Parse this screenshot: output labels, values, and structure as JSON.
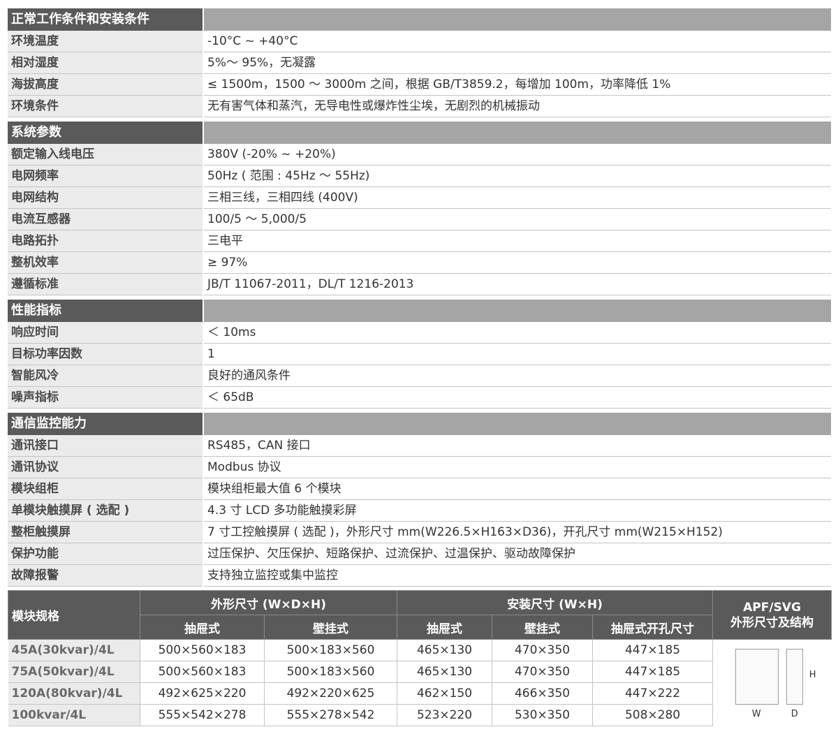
{
  "sections": [
    {
      "title": "正常工作条件和安装条件",
      "rows": [
        {
          "label": "环境温度",
          "value": "-10°C ~ +40°C"
        },
        {
          "label": "相对湿度",
          "value": "5%～ 95%，无凝露"
        },
        {
          "label": "海拔高度",
          "value": "≤ 1500m，1500 ～ 3000m 之间，根据 GB/T3859.2，每增加 100m，功率降低 1%"
        },
        {
          "label": "环境条件",
          "value": "无有害气体和蒸汽，无导电性或爆炸性尘埃，无剧烈的机械振动"
        }
      ]
    },
    {
      "title": "系统参数",
      "rows": [
        {
          "label": "额定输入线电压",
          "value": "380V (-20% ~ +20%)"
        },
        {
          "label": "电网频率",
          "value": "50Hz ( 范围 : 45Hz ～ 55Hz)"
        },
        {
          "label": "电网结构",
          "value": "三相三线，三相四线 (400V)"
        },
        {
          "label": "电流互感器",
          "value": "100/5 ～ 5,000/5"
        },
        {
          "label": "电路拓扑",
          "value": "三电平"
        },
        {
          "label": "整机效率",
          "value": "≥ 97%"
        },
        {
          "label": "遵循标准",
          "value": "JB/T 11067-2011，DL/T 1216-2013"
        }
      ]
    },
    {
      "title": "性能指标",
      "rows": [
        {
          "label": "响应时间",
          "value": "＜ 10ms"
        },
        {
          "label": "目标功率因数",
          "value": "1"
        },
        {
          "label": "智能风冷",
          "value": "良好的通风条件"
        },
        {
          "label": "噪声指标",
          "value": "＜ 65dB"
        }
      ]
    },
    {
      "title": "通信监控能力",
      "rows": [
        {
          "label": "通讯接口",
          "value": "RS485，CAN 接口"
        },
        {
          "label": "通讯协议",
          "value": "Modbus 协议"
        },
        {
          "label": "模块组柜",
          "value": "模块组柜最大值 6 个模块"
        },
        {
          "label": "单模块触摸屏 ( 选配 )",
          "value": "4.3 寸 LCD 多功能触摸彩屏"
        },
        {
          "label": "整柜触摸屏",
          "value": "7 寸工控触摸屏 ( 选配 )，外形尺寸 mm(W226.5×H163×D36)，开孔尺寸 mm(W215×H152)"
        },
        {
          "label": "保护功能",
          "value": "过压保护、欠压保护、短路保护、过流保护、过温保护、驱动故障保护"
        },
        {
          "label": "故障报警",
          "value": "支持独立监控或集中监控"
        }
      ]
    }
  ],
  "dimensions": {
    "header": {
      "model": "模块规格",
      "outer": "外形尺寸 (W×D×H)",
      "install": "安装尺寸 (W×H)",
      "apf": "APF/SVG\n外形尺寸及结构",
      "drawer": "抽屉式",
      "wall": "壁挂式",
      "install_drawer": "抽屉式",
      "install_wall": "壁挂式",
      "cutout": "抽屉式开孔尺寸"
    },
    "rows": [
      {
        "model": "45A(30kvar)/4L",
        "outer_drawer": "500×560×183",
        "outer_wall": "500×183×560",
        "inst_drawer": "465×130",
        "inst_wall": "470×350",
        "cutout": "447×185"
      },
      {
        "model": "75A(50kvar)/4L",
        "outer_drawer": "500×560×183",
        "outer_wall": "500×183×560",
        "inst_drawer": "465×130",
        "inst_wall": "470×350",
        "cutout": "447×185"
      },
      {
        "model": "120A(80kvar)/4L",
        "outer_drawer": "492×625×220",
        "outer_wall": "492×220×625",
        "inst_drawer": "462×150",
        "inst_wall": "466×350",
        "cutout": "447×222"
      },
      {
        "model": "100kvar/4L",
        "outer_drawer": "555×542×278",
        "outer_wall": "555×278×542",
        "inst_drawer": "523×220",
        "inst_wall": "530×350",
        "cutout": "508×280"
      }
    ],
    "diagram_labels": {
      "h": "H",
      "w": "W",
      "d": "D"
    }
  }
}
